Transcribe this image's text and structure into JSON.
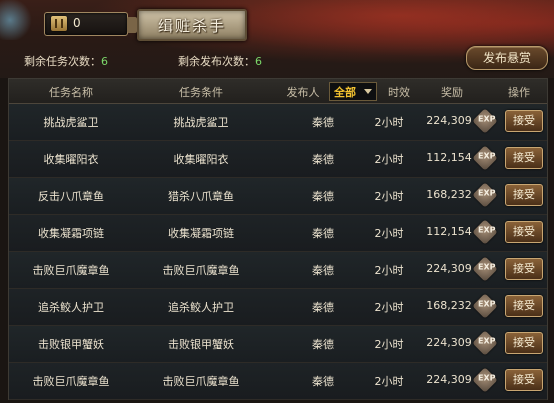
{
  "currency": {
    "icon": "ticket-icon",
    "value": "0"
  },
  "title": "缉赃杀手",
  "counters": {
    "remaining_tasks_label": "剩余任务次数：",
    "remaining_tasks_value": "6",
    "remaining_publish_label": "剩余发布次数：",
    "remaining_publish_value": "6"
  },
  "publish_button": "发布悬赏",
  "table": {
    "headers": {
      "name": "任务名称",
      "condition": "任务条件",
      "publisher": "发布人",
      "duration": "时效",
      "reward": "奖励",
      "action": "操作"
    },
    "filter_value": "全部",
    "exp_label": "EXP",
    "accept_label": "接受",
    "rows": [
      {
        "name": "挑战虎鲨卫",
        "condition": "挑战虎鲨卫",
        "publisher": "秦德",
        "duration": "2小时",
        "reward": "224,309"
      },
      {
        "name": "收集曜阳衣",
        "condition": "收集曜阳衣",
        "publisher": "秦德",
        "duration": "2小时",
        "reward": "112,154"
      },
      {
        "name": "反击八爪章鱼",
        "condition": "猎杀八爪章鱼",
        "publisher": "秦德",
        "duration": "2小时",
        "reward": "168,232"
      },
      {
        "name": "收集凝霜项链",
        "condition": "收集凝霜项链",
        "publisher": "秦德",
        "duration": "2小时",
        "reward": "112,154"
      },
      {
        "name": "击败巨爪魔章鱼",
        "condition": "击败巨爪魔章鱼",
        "publisher": "秦德",
        "duration": "2小时",
        "reward": "224,309"
      },
      {
        "name": "追杀鲛人护卫",
        "condition": "追杀鲛人护卫",
        "publisher": "秦德",
        "duration": "2小时",
        "reward": "168,232"
      },
      {
        "name": "击败银甲蟹妖",
        "condition": "击败银甲蟹妖",
        "publisher": "秦德",
        "duration": "2小时",
        "reward": "224,309"
      },
      {
        "name": "击败巨爪魔章鱼",
        "condition": "击败巨爪魔章鱼",
        "publisher": "秦德",
        "duration": "2小时",
        "reward": "224,309"
      }
    ]
  }
}
